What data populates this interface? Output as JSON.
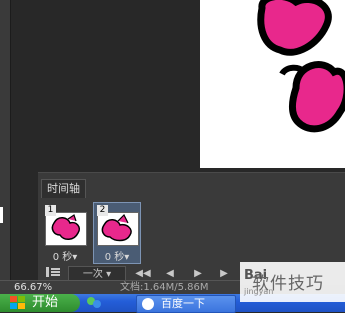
{
  "timeline": {
    "tab_label": "时间轴",
    "frames": [
      {
        "number": "1",
        "delay": "0 秒▾"
      },
      {
        "number": "2",
        "delay": "0 秒▾"
      }
    ],
    "loop_label": "一次",
    "controls": {
      "first": "◀◀",
      "prev": "◀",
      "play": "▶",
      "next": "▶"
    }
  },
  "status_bar": {
    "zoom": "66.67%",
    "doc_info": "文档:1.64M/5.86M"
  },
  "taskbar": {
    "start_label": "开始",
    "task_label": "百度一下"
  },
  "watermark": {
    "brand": "Bai",
    "text": "软件技巧",
    "site": "jingyan"
  },
  "colors": {
    "shape_fill": "#e8288c",
    "shape_outline": "#000000",
    "panel_bg": "#3a3a3a",
    "selected_frame": "#4a5c74",
    "taskbar_blue": "#245ed8",
    "start_green": "#3a9d3a"
  }
}
